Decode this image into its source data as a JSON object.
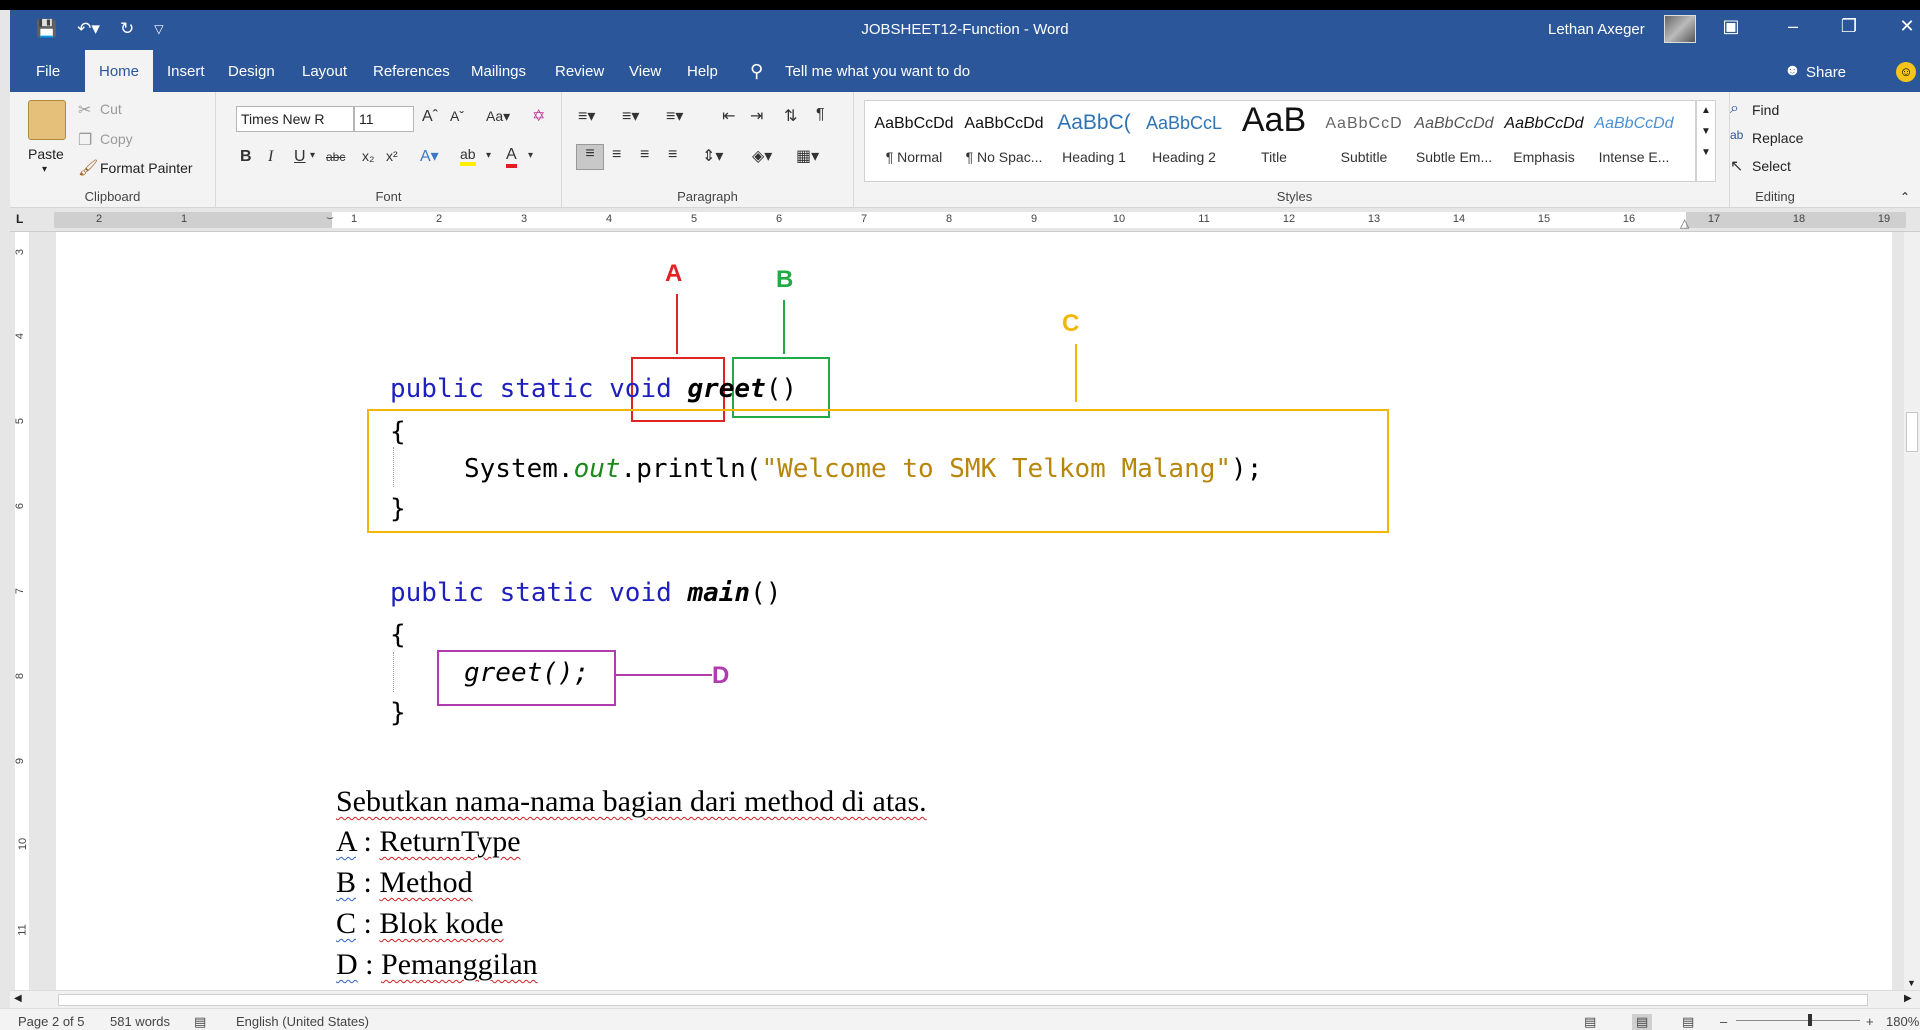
{
  "window": {
    "title": "JOBSHEET12-Function  -  Word",
    "user": "Lethan Axeger",
    "restore_icon": "restore-icon",
    "close_icon": "close-icon"
  },
  "ribbon_tabs": [
    "File",
    "Home",
    "Insert",
    "Design",
    "Layout",
    "References",
    "Mailings",
    "Review",
    "View",
    "Help"
  ],
  "tell_me": "Tell me what you want to do",
  "share": "Share",
  "clipboard": {
    "paste": "Paste",
    "cut": "Cut",
    "copy": "Copy",
    "format_painter": "Format Painter",
    "label": "Clipboard"
  },
  "font": {
    "name": "Times New R",
    "size": "11",
    "label": "Font"
  },
  "paragraph": {
    "label": "Paragraph"
  },
  "styles": {
    "label": "Styles",
    "items": [
      {
        "preview": "AaBbCcDd",
        "name": "¶ Normal"
      },
      {
        "preview": "AaBbCcDd",
        "name": "¶ No Spac..."
      },
      {
        "preview": "AaBbC(",
        "name": "Heading 1"
      },
      {
        "preview": "AaBbCcL",
        "name": "Heading 2"
      },
      {
        "preview": "AaB",
        "name": "Title"
      },
      {
        "preview": "AaBbCcD",
        "name": "Subtitle"
      },
      {
        "preview": "AaBbCcDd",
        "name": "Subtle Em..."
      },
      {
        "preview": "AaBbCcDd",
        "name": "Emphasis"
      },
      {
        "preview": "AaBbCcDd",
        "name": "Intense E..."
      }
    ]
  },
  "editing": {
    "find": "Find",
    "replace": "Replace",
    "select": "Select",
    "label": "Editing"
  },
  "ruler_numbers": [
    "2",
    "1",
    "1",
    "2",
    "3",
    "4",
    "5",
    "6",
    "7",
    "8",
    "9",
    "10",
    "11",
    "12",
    "13",
    "14",
    "15",
    "16",
    "17",
    "18",
    "19"
  ],
  "vruler_numbers": [
    "3",
    "4",
    "5",
    "6",
    "7",
    "8",
    "9",
    "10",
    "11"
  ],
  "figure": {
    "labels": {
      "a": "A",
      "b": "B",
      "c": "C",
      "d": "D"
    },
    "greet_sig": {
      "public": "public",
      "static": "static",
      "void": "void",
      "name": "greet",
      "parens": "()"
    },
    "open_brace": "{",
    "println": {
      "system": "System.",
      "out": "out",
      "println": ".println(",
      "str": "\"Welcome to SMK Telkom Malang\"",
      "end": ");"
    },
    "close_brace": "}",
    "main_sig": {
      "public": "public",
      "static": "static",
      "void": "void",
      "name": "main",
      "parens": "()"
    },
    "call": "greet();"
  },
  "body": {
    "question": "Sebutkan nama-nama bagian dari method di atas.",
    "answers": [
      {
        "key": "A",
        "sep": " : ",
        "value": "ReturnType"
      },
      {
        "key": "B",
        "sep": " : ",
        "value": "Method"
      },
      {
        "key": "C",
        "sep": " : ",
        "value": "Blok kode"
      },
      {
        "key": "D",
        "sep": " : ",
        "value": "Pemanggilan"
      }
    ]
  },
  "status": {
    "page": "Page 2 of 5",
    "words": "581 words",
    "language": "English (United States)",
    "zoom": "180%"
  },
  "colors": {
    "ribbon_blue": "#2b579a",
    "label_a": "#e02424",
    "label_b": "#22aa44",
    "label_c": "#f2b705",
    "label_d": "#b03cb0"
  }
}
